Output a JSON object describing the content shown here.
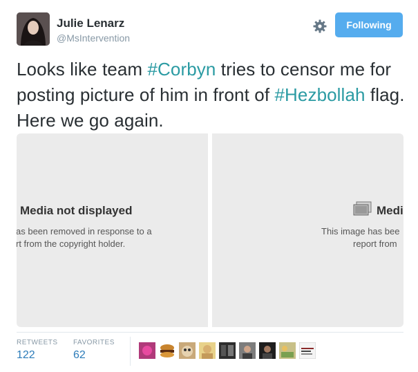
{
  "author": {
    "name": "Julie Lenarz",
    "handle": "@MsIntervention"
  },
  "actions": {
    "follow_label": "Following",
    "settings_icon": "gear-icon"
  },
  "tweet": {
    "segments": [
      {
        "text": "Looks like team ",
        "tag": false
      },
      {
        "text": "#Corbyn",
        "tag": true
      },
      {
        "text": " tries to censor me for posting picture of him in front of ",
        "tag": false
      },
      {
        "text": "#Hezbollah",
        "tag": true
      },
      {
        "text": " flag. Here we go again.",
        "tag": false
      }
    ]
  },
  "media": {
    "left": {
      "title": "Media not displayed",
      "lines": [
        "as been removed in response to a",
        "rt from the copyright holder."
      ]
    },
    "right": {
      "title": "Medi",
      "lines": [
        "This image has bee",
        "report from"
      ]
    }
  },
  "stats": {
    "retweets_label": "RETWEETS",
    "retweets": "122",
    "favorites_label": "FAVORITES",
    "favorites": "62"
  },
  "colors": {
    "hashtag": "#2b9ba3",
    "button": "#55acee",
    "stat_value": "#2b7bb9"
  }
}
